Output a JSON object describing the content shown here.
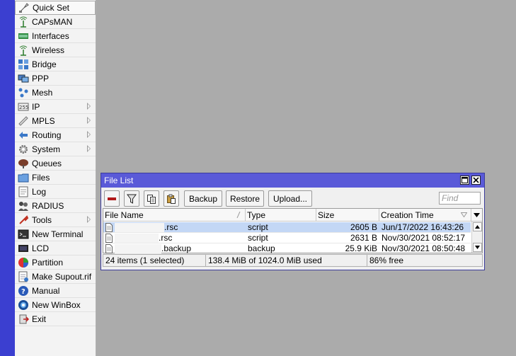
{
  "menu": {
    "items": [
      {
        "label": "Quick Set",
        "icon": "quick-set-icon",
        "arrow": false
      },
      {
        "label": "CAPsMAN",
        "icon": "capsman-icon",
        "arrow": false
      },
      {
        "label": "Interfaces",
        "icon": "interfaces-icon",
        "arrow": false
      },
      {
        "label": "Wireless",
        "icon": "wireless-icon",
        "arrow": false
      },
      {
        "label": "Bridge",
        "icon": "bridge-icon",
        "arrow": false
      },
      {
        "label": "PPP",
        "icon": "ppp-icon",
        "arrow": false
      },
      {
        "label": "Mesh",
        "icon": "mesh-icon",
        "arrow": false
      },
      {
        "label": "IP",
        "icon": "ip-icon",
        "arrow": true
      },
      {
        "label": "MPLS",
        "icon": "mpls-icon",
        "arrow": true
      },
      {
        "label": "Routing",
        "icon": "routing-icon",
        "arrow": true
      },
      {
        "label": "System",
        "icon": "system-icon",
        "arrow": true
      },
      {
        "label": "Queues",
        "icon": "queues-icon",
        "arrow": false
      },
      {
        "label": "Files",
        "icon": "files-icon",
        "arrow": false
      },
      {
        "label": "Log",
        "icon": "log-icon",
        "arrow": false
      },
      {
        "label": "RADIUS",
        "icon": "radius-icon",
        "arrow": false
      },
      {
        "label": "Tools",
        "icon": "tools-icon",
        "arrow": true
      },
      {
        "label": "New Terminal",
        "icon": "terminal-icon",
        "arrow": false
      },
      {
        "label": "LCD",
        "icon": "lcd-icon",
        "arrow": false
      },
      {
        "label": "Partition",
        "icon": "partition-icon",
        "arrow": false
      },
      {
        "label": "Make Supout.rif",
        "icon": "supout-icon",
        "arrow": false
      },
      {
        "label": "Manual",
        "icon": "manual-icon",
        "arrow": false
      },
      {
        "label": "New WinBox",
        "icon": "winbox-icon",
        "arrow": false
      },
      {
        "label": "Exit",
        "icon": "exit-icon",
        "arrow": false
      }
    ]
  },
  "window": {
    "title": "File List",
    "toolbar": {
      "backup_label": "Backup",
      "restore_label": "Restore",
      "upload_label": "Upload...",
      "find_placeholder": "Find"
    },
    "columns": [
      "File Name",
      "Type",
      "Size",
      "Creation Time"
    ],
    "rows": [
      {
        "name": ".rsc",
        "type": "script",
        "size": "2605 B",
        "created": "Jun/17/2022 16:43:26",
        "selected": true
      },
      {
        "name": ".rsc",
        "type": "script",
        "size": "2631 B",
        "created": "Nov/30/2021 08:52:17",
        "selected": false
      },
      {
        "name": ".backup",
        "type": "backup",
        "size": "25.9 KiB",
        "created": "Nov/30/2021 08:50:48",
        "selected": false
      }
    ],
    "status": {
      "items": "24 items (1 selected)",
      "usage": "138.4 MiB of 1024.0 MiB used",
      "free": "86% free"
    }
  }
}
